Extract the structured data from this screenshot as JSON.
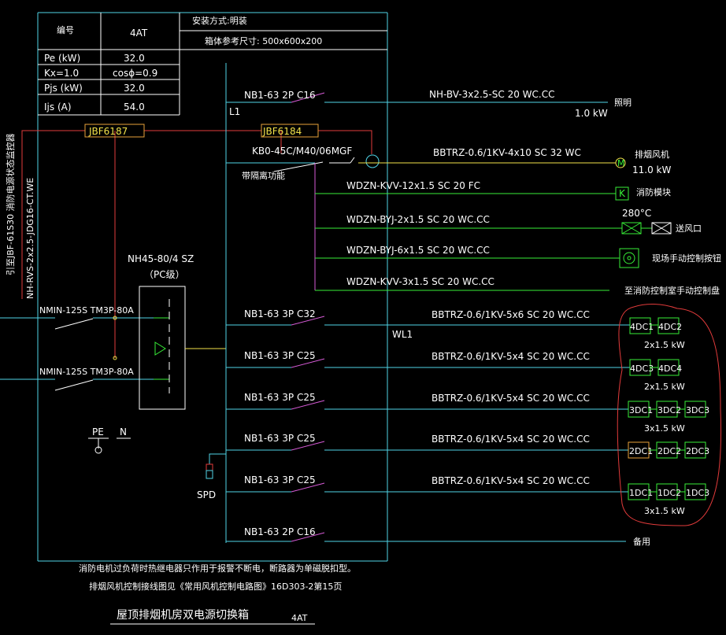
{
  "table": {
    "name_label": "编号",
    "name_value": "4AT",
    "install_label": "安装方式:明装",
    "box_size": "箱体参考尺寸: 500x600x200",
    "rows": [
      {
        "k": "Pe (kW)",
        "v": "32.0"
      },
      {
        "k": "Kx=1.0",
        "v": "cosϕ=0.9"
      },
      {
        "k": "Pjs (kW)",
        "v": "32.0"
      },
      {
        "k": "Ijs (A)",
        "v": "54.0"
      }
    ]
  },
  "incoming": {
    "vertical_label": "引至JBF-61S30 消防电源状态监控器",
    "vertical_cable": "NH-RVS-2x2.5-JDG16-CT.WE",
    "jbf1": "JBF6187",
    "jbf2": "JBF6184",
    "breaker1": "NMIN-125S TM3P-80A",
    "breaker2": "NMIN-125S TM3P-80A",
    "ats_model": "NH45-80/4 SZ",
    "ats_level": "（PC级）",
    "pe": "PE",
    "n": "N",
    "spd": "SPD",
    "l1": "L1",
    "wl1": "WL1"
  },
  "circuits": [
    {
      "breaker": "NB1-63 2P C16",
      "cable": "NH-BV-3x2.5-SC 20  WC.CC",
      "load": "照明",
      "power": "1.0 kW"
    },
    {
      "breaker": "KB0-45C/M40/06MGF",
      "note": "带隔离功能",
      "cable": "BBTRZ-0.6/1KV-4x10  SC 32  WC",
      "load": "排烟风机",
      "power": "11.0 kW"
    },
    {
      "cable": "WDZN-KVV-12x1.5  SC 20  FC",
      "load": "消防模块",
      "symbol": "K"
    },
    {
      "cable": "WDZN-BYJ-2x1.5  SC 20  WC.CC",
      "load": "送风口",
      "temp": "280°C"
    },
    {
      "cable": "WDZN-BYJ-6x1.5  SC 20  WC.CC",
      "load": "现场手动控制按钮"
    },
    {
      "cable": "WDZN-KVV-3x1.5  SC 20  WC.CC",
      "load": "至消防控制室手动控制盘"
    },
    {
      "breaker": "NB1-63 3P C32",
      "cable": "BBTRZ-0.6/1KV-5x6  SC 20  WC.CC",
      "boxes": [
        "4DC1",
        "4DC2"
      ],
      "power": "2x1.5 kW"
    },
    {
      "breaker": "NB1-63 3P C25",
      "cable": "BBTRZ-0.6/1KV-5x4  SC 20  WC.CC",
      "boxes": [
        "4DC3",
        "4DC4"
      ],
      "power": "2x1.5 kW"
    },
    {
      "breaker": "NB1-63 3P C25",
      "cable": "BBTRZ-0.6/1KV-5x4  SC 20  WC.CC",
      "boxes": [
        "3DC1",
        "3DC2",
        "3DC3"
      ],
      "power": "3x1.5 kW"
    },
    {
      "breaker": "NB1-63 3P C25",
      "cable": "BBTRZ-0.6/1KV-5x4  SC 20  WC.CC",
      "boxes": [
        "2DC1",
        "2DC2",
        "2DC3"
      ],
      "power": "3x1.5 kW"
    },
    {
      "breaker": "NB1-63 3P C25",
      "cable": "BBTRZ-0.6/1KV-5x4  SC 20  WC.CC",
      "boxes": [
        "1DC1",
        "1DC2",
        "1DC3"
      ],
      "power": "3x1.5 kW"
    },
    {
      "breaker": "NB1-63 2P C16",
      "load": "备用"
    }
  ],
  "notes": {
    "note1": "消防电机过负荷时热继电器只作用于报警不断电，断路器为单磁脱扣型。",
    "note2": "排烟风机控制接线图见《常用风机控制电路图》16D303-2第15页",
    "title": "屋顶排烟机房双电源切换箱",
    "title_code": "4AT"
  },
  "colors": {
    "cyan": "#4fd3e6",
    "green": "#37ee37",
    "magenta": "#d65ad6",
    "red": "#e23b3b",
    "yellow": "#f2e24a",
    "orange": "#e8a23a"
  }
}
